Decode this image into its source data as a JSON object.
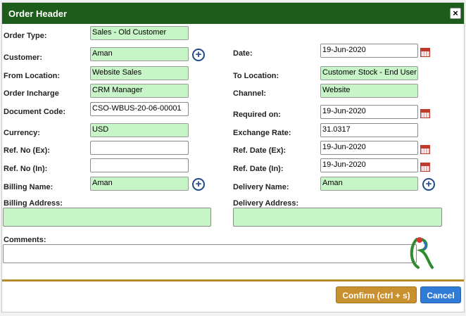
{
  "dialog": {
    "title": "Order Header",
    "close_symbol": "×"
  },
  "labels": {
    "order_type": "Order Type:",
    "customer": "Customer:",
    "from_location": "From Location:",
    "order_incharge": "Order Incharge",
    "document_code": "Document Code:",
    "currency": "Currency:",
    "ref_no_ex": "Ref. No (Ex):",
    "ref_no_in": "Ref. No (In):",
    "billing_name": "Billing Name:",
    "billing_address": "Billing Address:",
    "comments": "Comments:",
    "date": "Date:",
    "to_location": "To Location:",
    "channel": "Channel:",
    "required_on": "Required on:",
    "exchange_rate": "Exchange Rate:",
    "ref_date_ex": "Ref. Date (Ex):",
    "ref_date_in": "Ref. Date (In):",
    "delivery_name": "Delivery Name:",
    "delivery_address": "Delivery Address:"
  },
  "values": {
    "order_type": "Sales - Old Customer",
    "customer": "Aman",
    "from_location": "Website Sales",
    "order_incharge": "CRM  Manager",
    "document_code": "CSO-WBUS-20-06-00001",
    "currency": "USD",
    "ref_no_ex": "",
    "ref_no_in": "",
    "billing_name": "Aman",
    "date": "19-Jun-2020",
    "to_location": "Customer Stock - End User",
    "channel": "Website",
    "required_on": "19-Jun-2020",
    "exchange_rate": "31.0317",
    "ref_date_ex": "19-Jun-2020",
    "ref_date_in": "19-Jun-2020",
    "delivery_name": "Aman"
  },
  "buttons": {
    "confirm": "Confirm (ctrl + s)",
    "cancel": "Cancel",
    "add_symbol": "+"
  },
  "colors": {
    "header": "#1d5c1a",
    "readonly_field": "#c8f5c8",
    "confirm": "#c8902e",
    "cancel": "#2f7bd6",
    "divider": "#b58a2a"
  }
}
